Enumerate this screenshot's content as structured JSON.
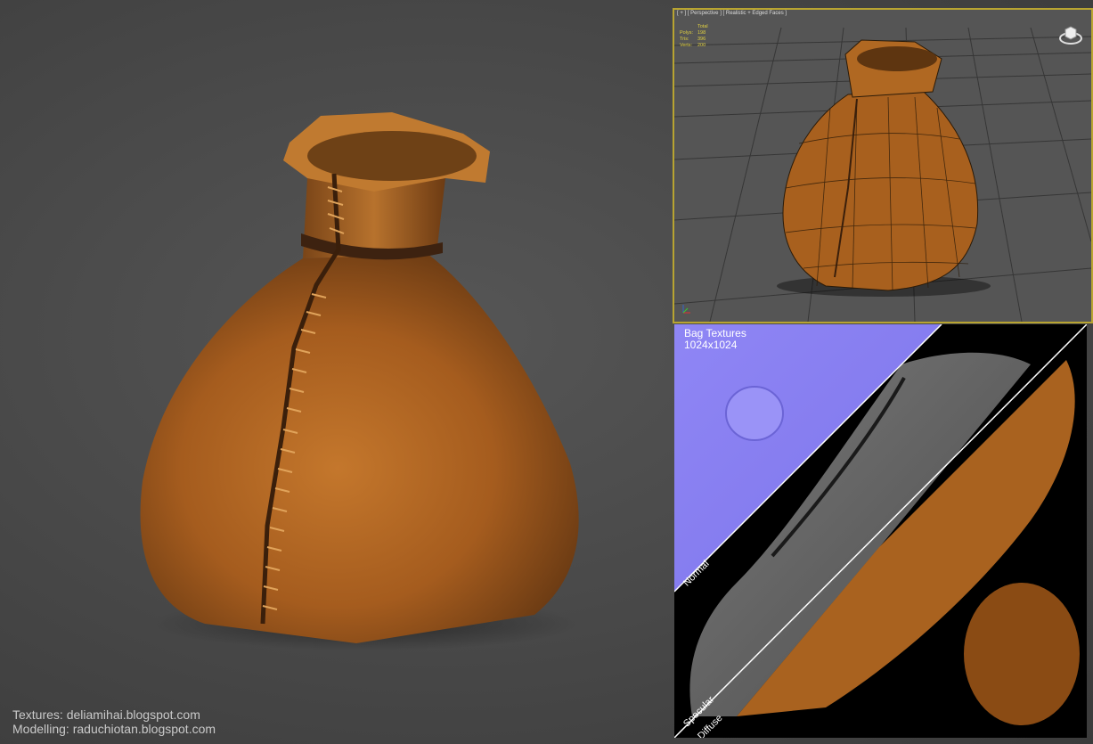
{
  "viewport": {
    "label": "[ + ] [ Perspective ] [ Realistic + Edged Faces ]",
    "stats": {
      "header": "Total",
      "rows": [
        {
          "key": "Polys:",
          "value": "198"
        },
        {
          "key": "Tris:",
          "value": "396"
        },
        {
          "key": "Verts:",
          "value": "200"
        }
      ]
    }
  },
  "textures": {
    "title": "Bag Textures",
    "resolution": "1024x1024",
    "maps": {
      "normal": "Normal",
      "specular": "Specular",
      "diffuse": "Diffuse"
    }
  },
  "credits": {
    "textures": "Textures: deliamihai.blogspot.com",
    "modelling": "Modelling: raduchiotan.blogspot.com"
  },
  "colors": {
    "leather": "#b96a22",
    "viewport_border": "#b8a431",
    "normal_map": "#8a80f0"
  }
}
